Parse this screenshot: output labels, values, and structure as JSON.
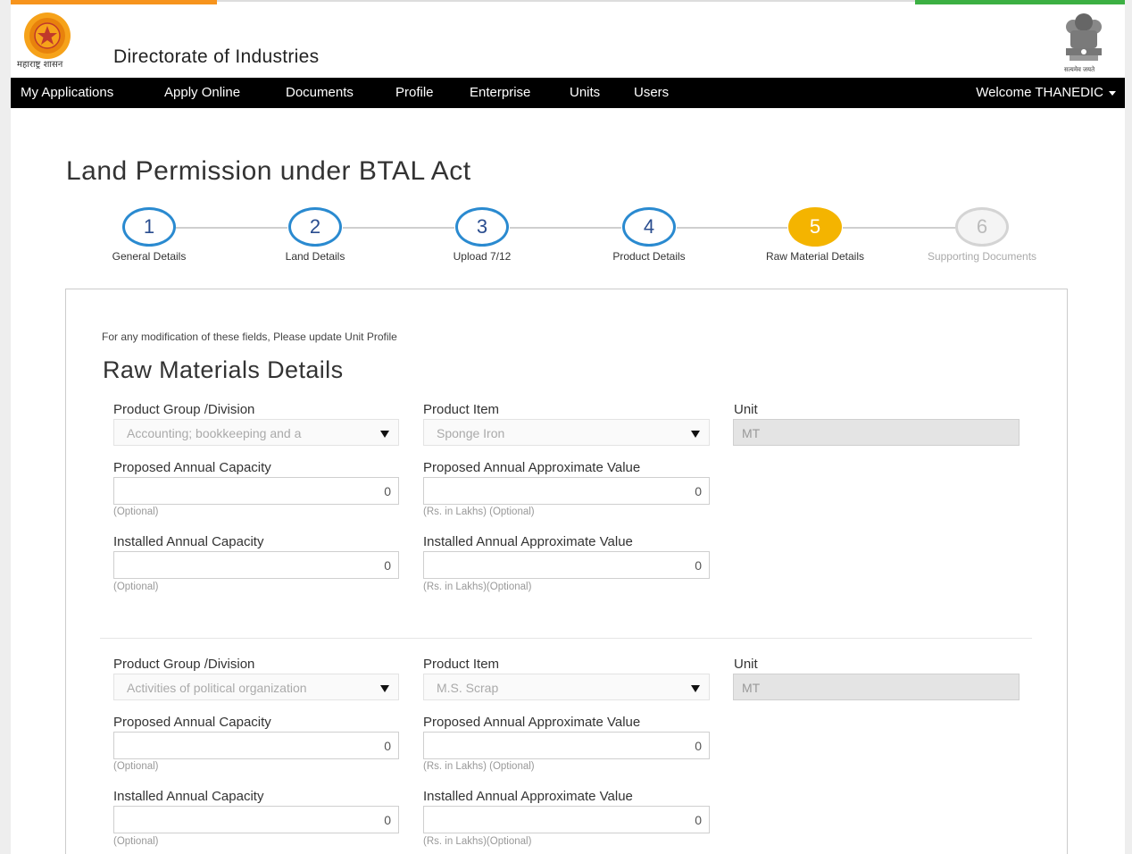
{
  "header": {
    "logo_caption": "महाराष्ट्र शासन",
    "site_title": "Directorate of Industries",
    "emblem_caption": "सत्यमेव जयते",
    "colors": {
      "orange": "#f7941d",
      "green": "#3cb043",
      "nav_bg": "#000000"
    }
  },
  "nav": {
    "items": [
      "My Applications",
      "Apply Online",
      "Documents",
      "Profile",
      "Enterprise",
      "Units",
      "Users"
    ],
    "welcome": "Welcome THANEDIC"
  },
  "page_title": "Land Permission under BTAL Act",
  "steps": [
    {
      "number": "1",
      "label": "General Details",
      "state": "done"
    },
    {
      "number": "2",
      "label": "Land Details",
      "state": "done"
    },
    {
      "number": "3",
      "label": "Upload 7/12",
      "state": "done"
    },
    {
      "number": "4",
      "label": "Product Details",
      "state": "done"
    },
    {
      "number": "5",
      "label": "Raw Material Details",
      "state": "active"
    },
    {
      "number": "6",
      "label": "Supporting Documents",
      "state": "disabled"
    }
  ],
  "form": {
    "note": "For any modification of these fields, Please update Unit Profile",
    "title": "Raw Materials Details",
    "blocks": [
      {
        "product_group_label": "Product Group /Division",
        "product_group_value": "Accounting; bookkeeping and a",
        "product_item_label": "Product Item",
        "product_item_value": "Sponge Iron",
        "unit_label": "Unit",
        "unit_value": "MT",
        "proposed_capacity_label": "Proposed Annual Capacity",
        "proposed_capacity_value": "0",
        "proposed_capacity_hint": "(Optional)",
        "proposed_value_label": "Proposed Annual Approximate Value",
        "proposed_value_value": "0",
        "proposed_value_hint": "(Rs. in Lakhs) (Optional)",
        "installed_capacity_label": "Installed Annual Capacity",
        "installed_capacity_value": "0",
        "installed_capacity_hint": "(Optional)",
        "installed_value_label": "Installed Annual Approximate Value",
        "installed_value_value": "0",
        "installed_value_hint": "(Rs. in Lakhs)(Optional)"
      },
      {
        "product_group_label": "Product Group /Division",
        "product_group_value": "Activities of political organization",
        "product_item_label": "Product Item",
        "product_item_value": "M.S. Scrap",
        "unit_label": "Unit",
        "unit_value": "MT",
        "proposed_capacity_label": "Proposed Annual Capacity",
        "proposed_capacity_value": "0",
        "proposed_capacity_hint": "(Optional)",
        "proposed_value_label": "Proposed Annual Approximate Value",
        "proposed_value_value": "0",
        "proposed_value_hint": "(Rs. in Lakhs) (Optional)",
        "installed_capacity_label": "Installed Annual Capacity",
        "installed_capacity_value": "0",
        "installed_capacity_hint": "(Optional)",
        "installed_value_label": "Installed Annual Approximate Value",
        "installed_value_value": "0",
        "installed_value_hint": "(Rs. in Lakhs)(Optional)"
      }
    ]
  }
}
